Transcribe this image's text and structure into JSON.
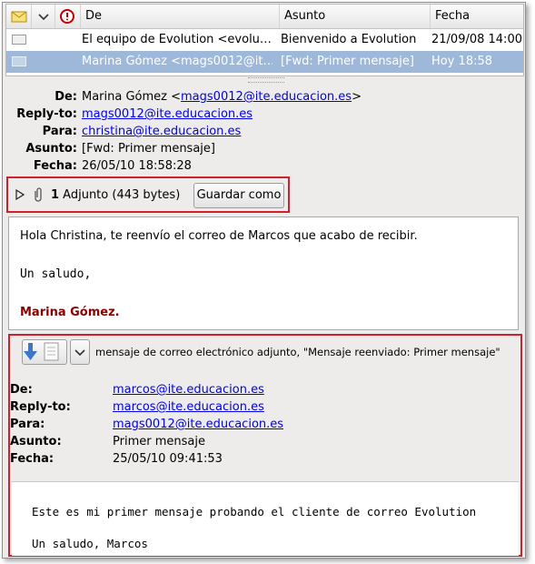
{
  "list": {
    "columns": {
      "from": "De",
      "subject": "Asunto",
      "date": "Fecha"
    },
    "rows": [
      {
        "from": "El equipo de Evolution <evolu…",
        "subject": "Bienvenido a Evolution",
        "date": "21/09/08 14:00",
        "selected": false
      },
      {
        "from": "Marina Gómez <mags0012@it…",
        "subject": "[Fwd: Primer mensaje]",
        "date": "Hoy 18:58",
        "selected": true
      }
    ]
  },
  "header": {
    "from_label": "De:",
    "from_name": "Marina Gómez <",
    "from_email": "mags0012@ite.educacion.es",
    "from_end": ">",
    "replyto_label": "Reply-to:",
    "replyto_email": "mags0012@ite.educacion.es",
    "to_label": "Para:",
    "to_email": "christina@ite.educacion.es",
    "subject_label": "Asunto:",
    "subject": "[Fwd: Primer mensaje]",
    "date_label": "Fecha:",
    "date": "26/05/10 18:58:28"
  },
  "attachment_bar": {
    "count": "1",
    "text": " Adjunto (443 bytes)",
    "save_button": "Guardar como"
  },
  "body": {
    "greeting": "Hola Christina, te reenvío el correo de Marcos que acabo de recibir.",
    "regards": "Un saludo,",
    "signature": "Marina Gómez."
  },
  "forwarded": {
    "description": "mensaje de correo electrónico adjunto, \"Mensaje reenviado: Primer mensaje\"",
    "from_label": "De:",
    "from_email": "marcos@ite.educacion.es",
    "replyto_label": "Reply-to:",
    "replyto_email": "marcos@ite.educacion.es",
    "to_label": "Para:",
    "to_email": "mags0012@ite.educacion.es",
    "subject_label": "Asunto:",
    "subject": "Primer mensaje",
    "date_label": "Fecha:",
    "date": "25/05/10 09:41:53",
    "body_line1": "Este es mi primer mensaje probando el cliente de correo Evolution",
    "body_line2": "Un saludo, Marcos"
  },
  "colors": {
    "highlight_box": "#d21f2c",
    "selection": "#9db8d8",
    "signature": "#8b0000",
    "link": "#0000ee"
  }
}
